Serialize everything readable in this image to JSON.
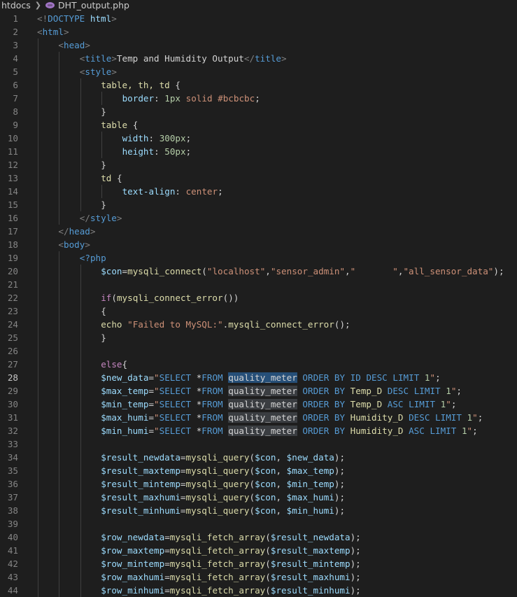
{
  "breadcrumb": {
    "folder": "htdocs",
    "file_icon": "php-icon",
    "file": "DHT_output.php"
  },
  "editor": {
    "active_line": 28,
    "lines": [
      {
        "n": "1",
        "indent": 0,
        "tokens": [
          [
            "b",
            "<!"
          ],
          [
            "t",
            "DOCTYPE"
          ],
          [
            "w",
            " "
          ],
          [
            "p",
            "html"
          ],
          [
            "b",
            ">"
          ]
        ]
      },
      {
        "n": "2",
        "indent": 0,
        "tokens": [
          [
            "b",
            "<"
          ],
          [
            "t",
            "html"
          ],
          [
            "b",
            ">"
          ]
        ]
      },
      {
        "n": "3",
        "indent": 1,
        "tokens": [
          [
            "b",
            "<"
          ],
          [
            "t",
            "head"
          ],
          [
            "b",
            ">"
          ]
        ]
      },
      {
        "n": "4",
        "indent": 2,
        "tokens": [
          [
            "b",
            "<"
          ],
          [
            "t",
            "title"
          ],
          [
            "b",
            ">"
          ],
          [
            "w",
            "Temp and Humidity Output"
          ],
          [
            "b",
            "</"
          ],
          [
            "t",
            "title"
          ],
          [
            "b",
            ">"
          ]
        ]
      },
      {
        "n": "5",
        "indent": 2,
        "tokens": [
          [
            "b",
            "<"
          ],
          [
            "t",
            "style"
          ],
          [
            "b",
            ">"
          ]
        ]
      },
      {
        "n": "6",
        "indent": 3,
        "tokens": [
          [
            "f",
            "table, th, td"
          ],
          [
            "w",
            " {"
          ]
        ]
      },
      {
        "n": "7",
        "indent": 4,
        "tokens": [
          [
            "p",
            "border"
          ],
          [
            "w",
            ": "
          ],
          [
            "v",
            "1px"
          ],
          [
            "w",
            " "
          ],
          [
            "s",
            "solid"
          ],
          [
            "w",
            " "
          ],
          [
            "s",
            "#bcbcbc"
          ],
          [
            "w",
            ";"
          ]
        ]
      },
      {
        "n": "8",
        "indent": 3,
        "tokens": [
          [
            "w",
            "}"
          ]
        ]
      },
      {
        "n": "9",
        "indent": 3,
        "tokens": [
          [
            "f",
            "table"
          ],
          [
            "w",
            " {"
          ]
        ]
      },
      {
        "n": "10",
        "indent": 4,
        "tokens": [
          [
            "p",
            "width"
          ],
          [
            "w",
            ": "
          ],
          [
            "v",
            "300px"
          ],
          [
            "w",
            ";"
          ]
        ]
      },
      {
        "n": "11",
        "indent": 4,
        "tokens": [
          [
            "p",
            "height"
          ],
          [
            "w",
            ": "
          ],
          [
            "v",
            "50px"
          ],
          [
            "w",
            ";"
          ]
        ]
      },
      {
        "n": "12",
        "indent": 3,
        "tokens": [
          [
            "w",
            "}"
          ]
        ]
      },
      {
        "n": "13",
        "indent": 3,
        "tokens": [
          [
            "f",
            "td"
          ],
          [
            "w",
            " {"
          ]
        ]
      },
      {
        "n": "14",
        "indent": 4,
        "tokens": [
          [
            "p",
            "text-align"
          ],
          [
            "w",
            ": "
          ],
          [
            "s",
            "center"
          ],
          [
            "w",
            ";"
          ]
        ]
      },
      {
        "n": "15",
        "indent": 3,
        "tokens": [
          [
            "w",
            "}"
          ]
        ]
      },
      {
        "n": "16",
        "indent": 2,
        "tokens": [
          [
            "b",
            "</"
          ],
          [
            "t",
            "style"
          ],
          [
            "b",
            ">"
          ]
        ]
      },
      {
        "n": "17",
        "indent": 1,
        "tokens": [
          [
            "b",
            "</"
          ],
          [
            "t",
            "head"
          ],
          [
            "b",
            ">"
          ]
        ]
      },
      {
        "n": "18",
        "indent": 1,
        "tokens": [
          [
            "b",
            "<"
          ],
          [
            "t",
            "body"
          ],
          [
            "b",
            ">"
          ]
        ]
      },
      {
        "n": "19",
        "indent": 2,
        "tokens": [
          [
            "t",
            "<?php"
          ]
        ]
      },
      {
        "n": "20",
        "indent": 3,
        "tokens": [
          [
            "sv",
            "$con"
          ],
          [
            "w",
            "="
          ],
          [
            "f",
            "mysqli_connect"
          ],
          [
            "w",
            "("
          ],
          [
            "s",
            "\"localhost\""
          ],
          [
            "w",
            ","
          ],
          [
            "s",
            "\"sensor_admin\""
          ],
          [
            "w",
            ","
          ],
          [
            "s",
            "\"       \""
          ],
          [
            "w",
            ","
          ],
          [
            "s",
            "\"all_sensor_data\""
          ],
          [
            "w",
            ");"
          ]
        ]
      },
      {
        "n": "21",
        "indent": 3,
        "tokens": []
      },
      {
        "n": "22",
        "indent": 3,
        "tokens": [
          [
            "k",
            "if"
          ],
          [
            "w",
            "("
          ],
          [
            "f",
            "mysqli_connect_error"
          ],
          [
            "w",
            "())"
          ]
        ]
      },
      {
        "n": "23",
        "indent": 3,
        "tokens": [
          [
            "w",
            "{"
          ]
        ]
      },
      {
        "n": "24",
        "indent": 3,
        "tokens": [
          [
            "f",
            "echo"
          ],
          [
            "w",
            " "
          ],
          [
            "s",
            "\"Failed to MySQL:\""
          ],
          [
            "w",
            "."
          ],
          [
            "f",
            "mysqli_connect_error"
          ],
          [
            "w",
            "();"
          ]
        ]
      },
      {
        "n": "25",
        "indent": 3,
        "tokens": [
          [
            "w",
            "}"
          ]
        ]
      },
      {
        "n": "26",
        "indent": 3,
        "tokens": []
      },
      {
        "n": "27",
        "indent": 3,
        "tokens": [
          [
            "k",
            "else"
          ],
          [
            "w",
            "{"
          ]
        ]
      },
      {
        "n": "28",
        "indent": 3,
        "tokens": [
          [
            "sv",
            "$new_data"
          ],
          [
            "w",
            "="
          ],
          [
            "s",
            "\""
          ],
          [
            "t",
            "SELECT"
          ],
          [
            "w",
            " *"
          ],
          [
            "t",
            "FROM"
          ],
          [
            "w",
            " "
          ],
          [
            "hl",
            "quality_meter"
          ],
          [
            "w",
            " "
          ],
          [
            "t",
            "ORDER BY"
          ],
          [
            "w",
            " "
          ],
          [
            "t",
            "ID"
          ],
          [
            "w",
            " "
          ],
          [
            "t",
            "DESC"
          ],
          [
            "w",
            " "
          ],
          [
            "t",
            "LIMIT"
          ],
          [
            "w",
            " "
          ],
          [
            "v",
            "1"
          ],
          [
            "s",
            "\""
          ],
          [
            "w",
            ";"
          ]
        ]
      },
      {
        "n": "29",
        "indent": 3,
        "tokens": [
          [
            "sv",
            "$max_temp"
          ],
          [
            "w",
            "="
          ],
          [
            "s",
            "\""
          ],
          [
            "t",
            "SELECT"
          ],
          [
            "w",
            " *"
          ],
          [
            "t",
            "FROM"
          ],
          [
            "w",
            " "
          ],
          [
            "hl2",
            "quality_meter"
          ],
          [
            "w",
            " "
          ],
          [
            "t",
            "ORDER BY"
          ],
          [
            "w",
            " "
          ],
          [
            "f",
            "Temp_D"
          ],
          [
            "w",
            " "
          ],
          [
            "t",
            "DESC"
          ],
          [
            "w",
            " "
          ],
          [
            "t",
            "LIMIT"
          ],
          [
            "w",
            " "
          ],
          [
            "v",
            "1"
          ],
          [
            "s",
            "\""
          ],
          [
            "w",
            ";"
          ]
        ]
      },
      {
        "n": "30",
        "indent": 3,
        "tokens": [
          [
            "sv",
            "$min_temp"
          ],
          [
            "w",
            "="
          ],
          [
            "s",
            "\""
          ],
          [
            "t",
            "SELECT"
          ],
          [
            "w",
            " *"
          ],
          [
            "t",
            "FROM"
          ],
          [
            "w",
            " "
          ],
          [
            "hl2",
            "quality_meter"
          ],
          [
            "w",
            " "
          ],
          [
            "t",
            "ORDER BY"
          ],
          [
            "w",
            " "
          ],
          [
            "f",
            "Temp_D"
          ],
          [
            "w",
            " "
          ],
          [
            "t",
            "ASC"
          ],
          [
            "w",
            " "
          ],
          [
            "t",
            "LIMIT"
          ],
          [
            "w",
            " "
          ],
          [
            "v",
            "1"
          ],
          [
            "s",
            "\""
          ],
          [
            "w",
            ";"
          ]
        ]
      },
      {
        "n": "31",
        "indent": 3,
        "tokens": [
          [
            "sv",
            "$max_humi"
          ],
          [
            "w",
            "="
          ],
          [
            "s",
            "\""
          ],
          [
            "t",
            "SELECT"
          ],
          [
            "w",
            " *"
          ],
          [
            "t",
            "FROM"
          ],
          [
            "w",
            " "
          ],
          [
            "hl2",
            "quality_meter"
          ],
          [
            "w",
            " "
          ],
          [
            "t",
            "ORDER BY"
          ],
          [
            "w",
            " "
          ],
          [
            "f",
            "Humidity_D"
          ],
          [
            "w",
            " "
          ],
          [
            "t",
            "DESC"
          ],
          [
            "w",
            " "
          ],
          [
            "t",
            "LIMIT"
          ],
          [
            "w",
            " "
          ],
          [
            "v",
            "1"
          ],
          [
            "s",
            "\""
          ],
          [
            "w",
            ";"
          ]
        ]
      },
      {
        "n": "32",
        "indent": 3,
        "tokens": [
          [
            "sv",
            "$min_humi"
          ],
          [
            "w",
            "="
          ],
          [
            "s",
            "\""
          ],
          [
            "t",
            "SELECT"
          ],
          [
            "w",
            " *"
          ],
          [
            "t",
            "FROM"
          ],
          [
            "w",
            " "
          ],
          [
            "hl2",
            "quality_meter"
          ],
          [
            "w",
            " "
          ],
          [
            "t",
            "ORDER BY"
          ],
          [
            "w",
            " "
          ],
          [
            "f",
            "Humidity_D"
          ],
          [
            "w",
            " "
          ],
          [
            "t",
            "ASC"
          ],
          [
            "w",
            " "
          ],
          [
            "t",
            "LIMIT"
          ],
          [
            "w",
            " "
          ],
          [
            "v",
            "1"
          ],
          [
            "s",
            "\""
          ],
          [
            "w",
            ";"
          ]
        ]
      },
      {
        "n": "33",
        "indent": 3,
        "tokens": []
      },
      {
        "n": "34",
        "indent": 3,
        "tokens": [
          [
            "sv",
            "$result_newdata"
          ],
          [
            "w",
            "="
          ],
          [
            "f",
            "mysqli_query"
          ],
          [
            "w",
            "("
          ],
          [
            "sv",
            "$con"
          ],
          [
            "w",
            ", "
          ],
          [
            "sv",
            "$new_data"
          ],
          [
            "w",
            ");"
          ]
        ]
      },
      {
        "n": "35",
        "indent": 3,
        "tokens": [
          [
            "sv",
            "$result_maxtemp"
          ],
          [
            "w",
            "="
          ],
          [
            "f",
            "mysqli_query"
          ],
          [
            "w",
            "("
          ],
          [
            "sv",
            "$con"
          ],
          [
            "w",
            ", "
          ],
          [
            "sv",
            "$max_temp"
          ],
          [
            "w",
            ");"
          ]
        ]
      },
      {
        "n": "36",
        "indent": 3,
        "tokens": [
          [
            "sv",
            "$result_mintemp"
          ],
          [
            "w",
            "="
          ],
          [
            "f",
            "mysqli_query"
          ],
          [
            "w",
            "("
          ],
          [
            "sv",
            "$con"
          ],
          [
            "w",
            ", "
          ],
          [
            "sv",
            "$min_temp"
          ],
          [
            "w",
            ");"
          ]
        ]
      },
      {
        "n": "37",
        "indent": 3,
        "tokens": [
          [
            "sv",
            "$result_maxhumi"
          ],
          [
            "w",
            "="
          ],
          [
            "f",
            "mysqli_query"
          ],
          [
            "w",
            "("
          ],
          [
            "sv",
            "$con"
          ],
          [
            "w",
            ", "
          ],
          [
            "sv",
            "$max_humi"
          ],
          [
            "w",
            ");"
          ]
        ]
      },
      {
        "n": "38",
        "indent": 3,
        "tokens": [
          [
            "sv",
            "$result_minhumi"
          ],
          [
            "w",
            "="
          ],
          [
            "f",
            "mysqli_query"
          ],
          [
            "w",
            "("
          ],
          [
            "sv",
            "$con"
          ],
          [
            "w",
            ", "
          ],
          [
            "sv",
            "$min_humi"
          ],
          [
            "w",
            ");"
          ]
        ]
      },
      {
        "n": "39",
        "indent": 3,
        "tokens": []
      },
      {
        "n": "40",
        "indent": 3,
        "tokens": [
          [
            "sv",
            "$row_newdata"
          ],
          [
            "w",
            "="
          ],
          [
            "f",
            "mysqli_fetch_array"
          ],
          [
            "w",
            "("
          ],
          [
            "sv",
            "$result_newdata"
          ],
          [
            "w",
            ");"
          ]
        ]
      },
      {
        "n": "41",
        "indent": 3,
        "tokens": [
          [
            "sv",
            "$row_maxtemp"
          ],
          [
            "w",
            "="
          ],
          [
            "f",
            "mysqli_fetch_array"
          ],
          [
            "w",
            "("
          ],
          [
            "sv",
            "$result_maxtemp"
          ],
          [
            "w",
            ");"
          ]
        ]
      },
      {
        "n": "42",
        "indent": 3,
        "tokens": [
          [
            "sv",
            "$row_mintemp"
          ],
          [
            "w",
            "="
          ],
          [
            "f",
            "mysqli_fetch_array"
          ],
          [
            "w",
            "("
          ],
          [
            "sv",
            "$result_mintemp"
          ],
          [
            "w",
            ");"
          ]
        ]
      },
      {
        "n": "43",
        "indent": 3,
        "tokens": [
          [
            "sv",
            "$row_maxhumi"
          ],
          [
            "w",
            "="
          ],
          [
            "f",
            "mysqli_fetch_array"
          ],
          [
            "w",
            "("
          ],
          [
            "sv",
            "$result_maxhumi"
          ],
          [
            "w",
            ");"
          ]
        ]
      },
      {
        "n": "44",
        "indent": 3,
        "tokens": [
          [
            "sv",
            "$row_minhumi"
          ],
          [
            "w",
            "="
          ],
          [
            "f",
            "mysqli_fetch_array"
          ],
          [
            "w",
            "("
          ],
          [
            "sv",
            "$result_minhumi"
          ],
          [
            "w",
            ");"
          ]
        ]
      }
    ]
  }
}
